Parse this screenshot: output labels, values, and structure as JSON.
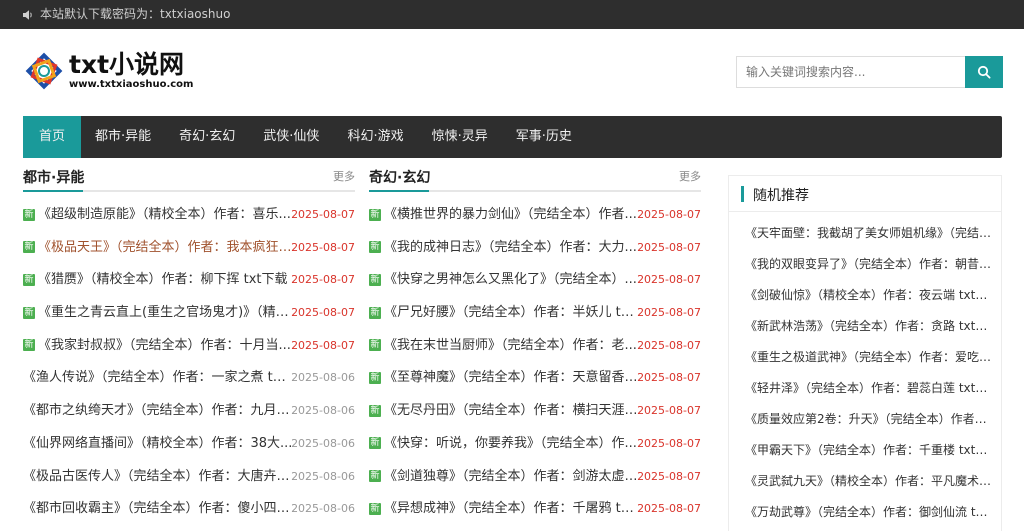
{
  "topbar": {
    "notice": "本站默认下载密码为：txtxiaoshuo"
  },
  "logo": {
    "name": "txt小说网",
    "url": "www.txtxiaoshuo.com"
  },
  "search": {
    "placeholder": "输入关键词搜索内容..."
  },
  "nav": {
    "items": [
      {
        "label": "首页",
        "active": true
      },
      {
        "label": "都市·异能"
      },
      {
        "label": "奇幻·玄幻"
      },
      {
        "label": "武侠·仙侠"
      },
      {
        "label": "科幻·游戏"
      },
      {
        "label": "惊悚·灵异"
      },
      {
        "label": "军事·历史"
      }
    ]
  },
  "columns": [
    {
      "title": "都市·异能",
      "more": "更多",
      "items": [
        {
          "text": "《超级制造原能》（精校全本）作者：喜乐...",
          "date": "2025-08-07",
          "new": true
        },
        {
          "text": "《极品天王》（完结全本）作者：我本疯狂 t...",
          "date": "2025-08-07",
          "new": true,
          "highlight": true
        },
        {
          "text": "《猎赝》（精校全本）作者：柳下挥 txt下载",
          "date": "2025-08-07",
          "new": true
        },
        {
          "text": "《重生之青云直上(重生之官场鬼才)》（精校...",
          "date": "2025-08-07",
          "new": true
        },
        {
          "text": "《我家封叔叔》（完结全本）作者：十月当...",
          "date": "2025-08-07",
          "new": true
        },
        {
          "text": "《渔人传说》（完结全本）作者：一家之煮 txt...",
          "date": "2025-08-06",
          "new": false
        },
        {
          "text": "《都市之纨绔天才》（完结全本）作者：九月阳...",
          "date": "2025-08-06",
          "new": false
        },
        {
          "text": "《仙界网络直播间》（精校全本）作者：38大...",
          "date": "2025-08-06",
          "new": false
        },
        {
          "text": "《极品古医传人》（完结全本）作者：大唐卉少...",
          "date": "2025-08-06",
          "new": false
        },
        {
          "text": "《都市回收霸主》（完结全本）作者：傻小四 tx...",
          "date": "2025-08-06",
          "new": false
        }
      ]
    },
    {
      "title": "奇幻·玄幻",
      "more": "更多",
      "items": [
        {
          "text": "《横推世界的暴力剑仙》（完结全本）作者...",
          "date": "2025-08-07",
          "new": true
        },
        {
          "text": "《我的成神日志》（完结全本）作者：大力...",
          "date": "2025-08-07",
          "new": true
        },
        {
          "text": "《快穿之男神怎么又黑化了》（完结全本）...",
          "date": "2025-08-07",
          "new": true
        },
        {
          "text": "《尸兄好腰》（完结全本）作者：半妖儿 txt...",
          "date": "2025-08-07",
          "new": true
        },
        {
          "text": "《我在末世当厨师》（完结全本）作者：老...",
          "date": "2025-08-07",
          "new": true
        },
        {
          "text": "《至尊神魔》（完结全本）作者：天意留香 t...",
          "date": "2025-08-07",
          "new": true
        },
        {
          "text": "《无尽丹田》（完结全本）作者：横扫天涯 t...",
          "date": "2025-08-07",
          "new": true
        },
        {
          "text": "《快穿：听说，你要养我》（完结全本）作...",
          "date": "2025-08-07",
          "new": true
        },
        {
          "text": "《剑道独尊》（完结全本）作者：剑游太虚 t...",
          "date": "2025-08-07",
          "new": true
        },
        {
          "text": "《异想成神》（完结全本）作者：千屠鸦 txt...",
          "date": "2025-08-07",
          "new": true
        }
      ]
    }
  ],
  "sidebar": {
    "title": "随机推荐",
    "items": [
      "《天牢面壁：我截胡了美女师姐机缘》（完结全...",
      "《我的双眼变异了》（完结全本）作者：朝昔 t...",
      "《剑破仙惊》（精校全本）作者：夜云端 txt下...",
      "《新武林浩荡》（完结全本）作者：贪路 txt下...",
      "《重生之极道武神》（完结全本）作者：爱吃橘...",
      "《轻井泽》（完结全本）作者：碧蕊白莲 txt下...",
      "《质量效应第2卷：升天》（完结全本）作者：...",
      "《甲霸天下》（完结全本）作者：千重楼 txt下...",
      "《灵武弑九天》（精校全本）作者：平凡魔术师...",
      "《万劫武尊》（完结全本）作者：御剑仙流 txt..."
    ]
  },
  "labels": {
    "new_badge": "新"
  },
  "colors": {
    "accent": "#1a9a9a",
    "dark": "#2e2e2e",
    "date_new": "#d9342b"
  }
}
